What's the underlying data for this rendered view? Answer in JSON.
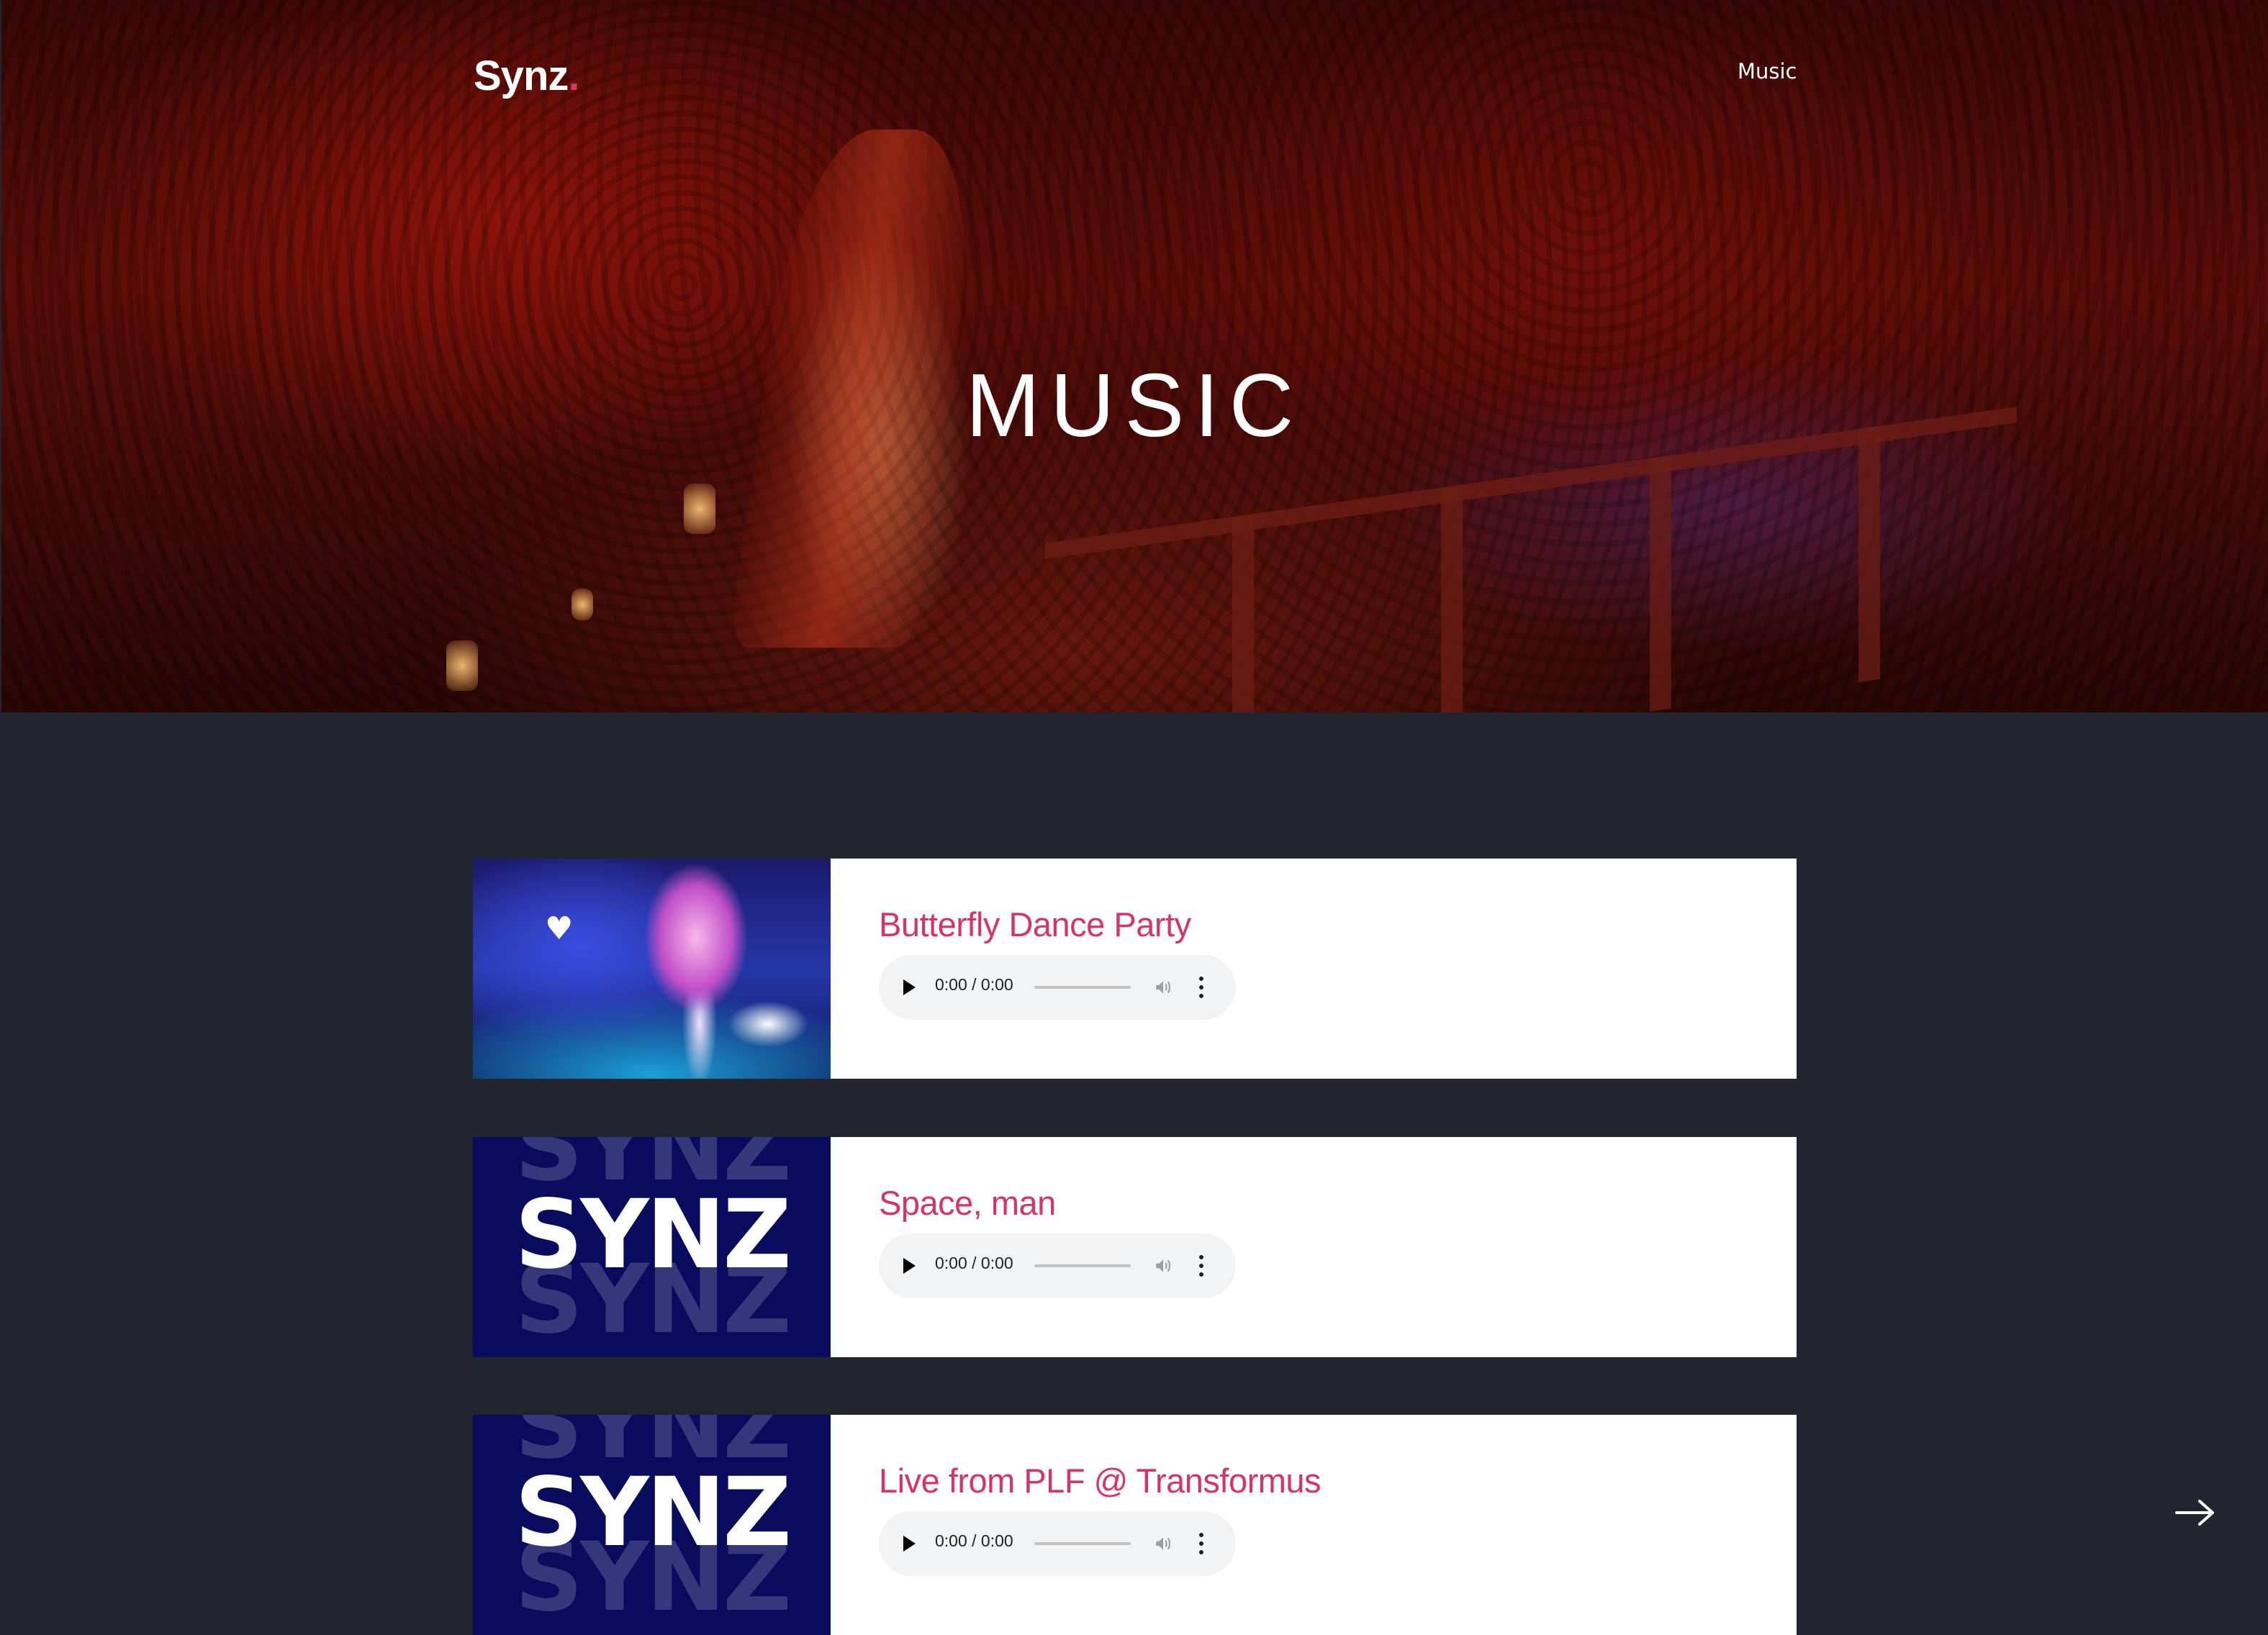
{
  "header": {
    "logo_text": "Synz",
    "logo_dot": ".",
    "nav": [
      {
        "label": "Music"
      }
    ]
  },
  "hero": {
    "title": "MUSIC"
  },
  "tracks": [
    {
      "title": "Butterfly Dance Party",
      "cover": "mushroom-art",
      "player": {
        "time": "0:00 / 0:00"
      }
    },
    {
      "title": "Space, man",
      "cover": "synz-logo",
      "cover_text": "SYNZ",
      "player": {
        "time": "0:00 / 0:00"
      }
    },
    {
      "title": "Live from PLF @ Transformus",
      "cover": "synz-logo",
      "cover_text": "SYNZ",
      "player": {
        "time": "0:00 / 0:00"
      }
    }
  ],
  "icons": {
    "play": "play-icon",
    "volume": "volume-icon",
    "more": "more-vertical-icon",
    "next": "arrow-right-icon"
  },
  "colors": {
    "accent": "#d6336c",
    "page_background": "#22252d",
    "card_background": "#ffffff",
    "synz_cover_background": "#090c5e",
    "player_background": "#f1f3f4"
  }
}
